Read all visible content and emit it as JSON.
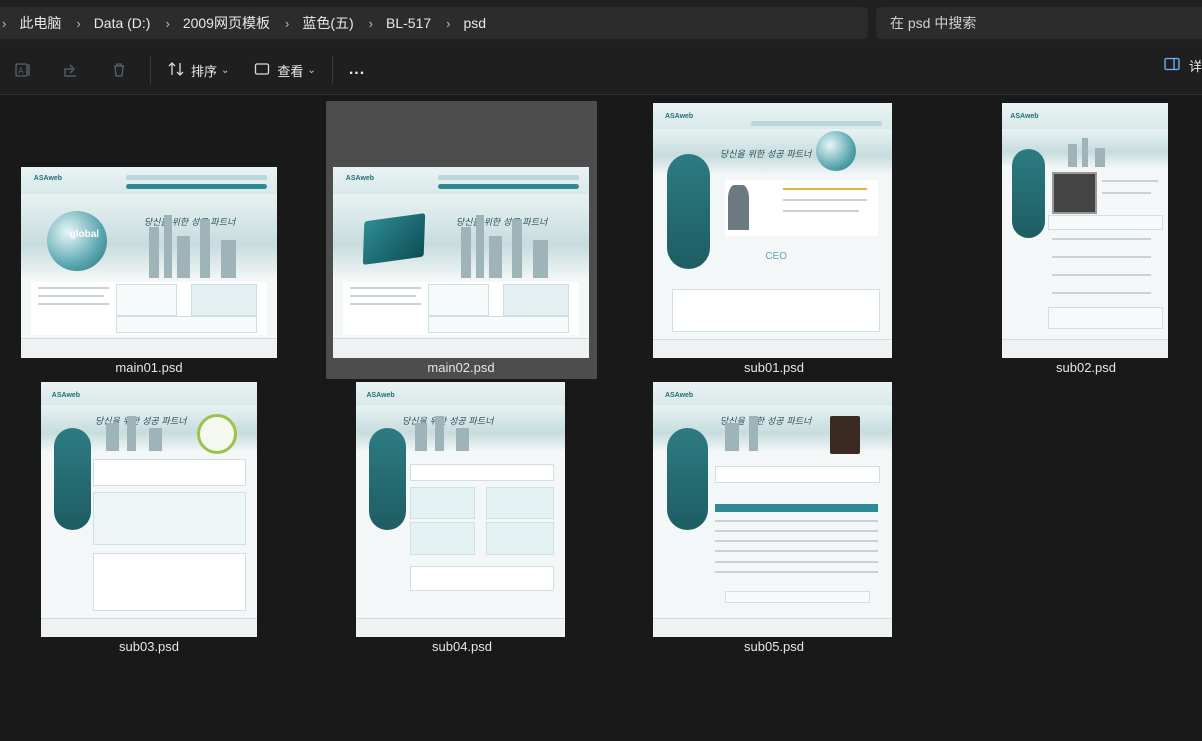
{
  "breadcrumb": {
    "items": [
      "此电脑",
      "Data (D:)",
      "2009网页模板",
      "蓝色(五)",
      "BL-517",
      "psd"
    ]
  },
  "search": {
    "placeholder": "在 psd 中搜索"
  },
  "toolbar": {
    "sort_label": "排序",
    "view_label": "查看",
    "more_label": "...",
    "details_label": "详"
  },
  "files": [
    {
      "name": "main01.psd",
      "selected": false
    },
    {
      "name": "main02.psd",
      "selected": true
    },
    {
      "name": "sub01.psd",
      "selected": false
    },
    {
      "name": "sub02.psd",
      "selected": false
    },
    {
      "name": "sub03.psd",
      "selected": false
    },
    {
      "name": "sub04.psd",
      "selected": false
    },
    {
      "name": "sub05.psd",
      "selected": false
    }
  ],
  "thumb_text": {
    "logo": "ASAweb",
    "slogan": "당신을 위한 성공 파트너",
    "globe": "global"
  },
  "colors": {
    "background": "#191919",
    "panel": "#2c2c2c",
    "selection": "#4d4d4d",
    "accent": "#2f8b93"
  }
}
